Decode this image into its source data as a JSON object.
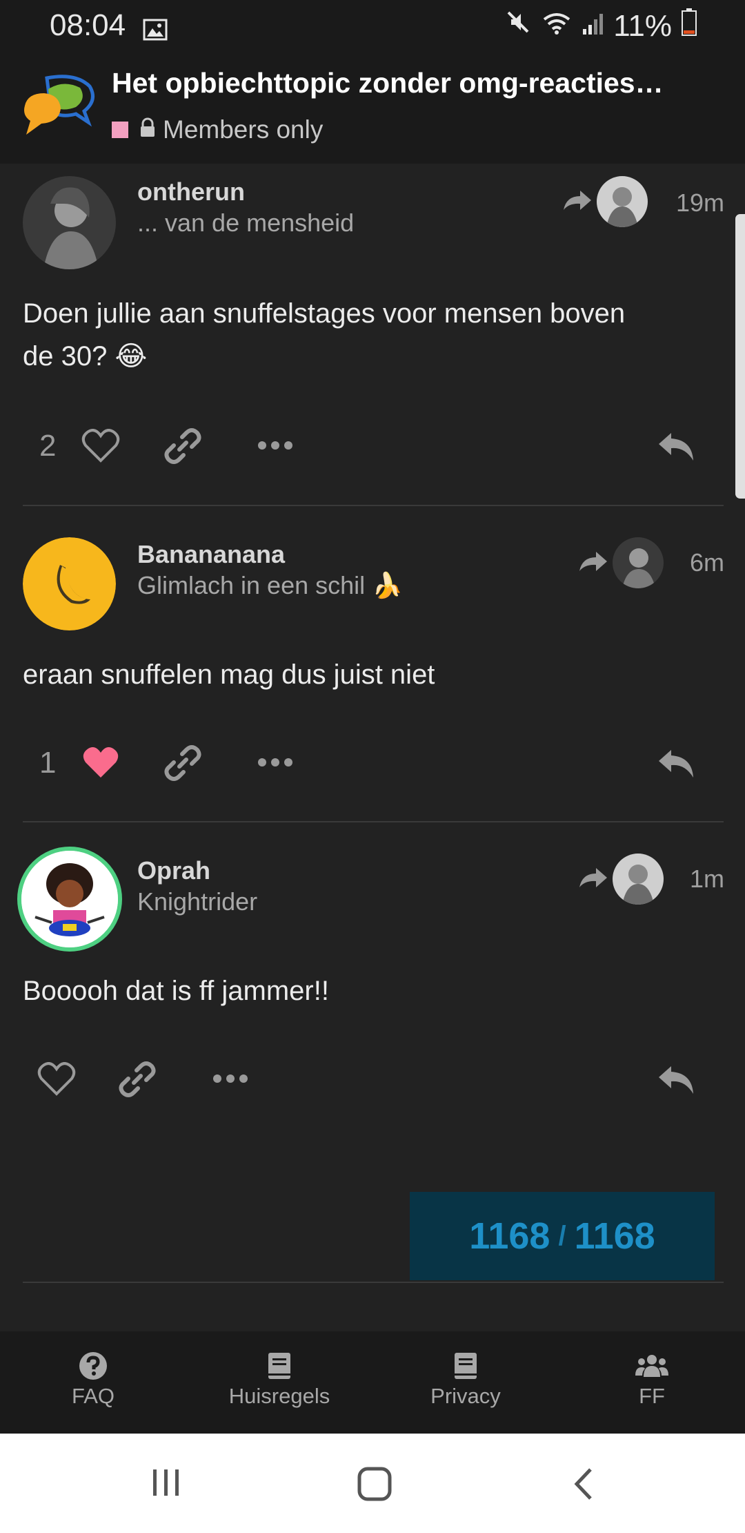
{
  "status_bar": {
    "time": "08:04",
    "battery": "11%"
  },
  "header": {
    "title": "Het opbiechttopic zonder omg-reacties…",
    "visibility": "Members only"
  },
  "posts": [
    {
      "username": "ontherun",
      "user_title": "... van de mensheid",
      "time": "19m",
      "body_line1": "Doen jullie aan snuffelstages voor mensen boven",
      "body_line2": "de 30? 😂",
      "like_count": "2",
      "liked": false
    },
    {
      "username": "Banananana",
      "user_title": "Glimlach in een schil 🍌",
      "time": "6m",
      "body_line1": "eraan snuffelen mag dus juist niet",
      "like_count": "1",
      "liked": true
    },
    {
      "username": "Oprah",
      "user_title": "Knightrider",
      "time": "1m",
      "body_line1": "Booooh dat is ff jammer!!",
      "like_count": "",
      "liked": false
    }
  ],
  "progress": {
    "current": "1168",
    "separator": "/",
    "total": "1168"
  },
  "bottom_nav": [
    {
      "label": "FAQ",
      "icon": "question-circle-icon"
    },
    {
      "label": "Huisregels",
      "icon": "book-icon"
    },
    {
      "label": "Privacy",
      "icon": "book-icon"
    },
    {
      "label": "FF",
      "icon": "users-icon"
    }
  ],
  "colors": {
    "accent": "#1e90c8",
    "like": "#fa6c8d",
    "background": "#222222"
  }
}
